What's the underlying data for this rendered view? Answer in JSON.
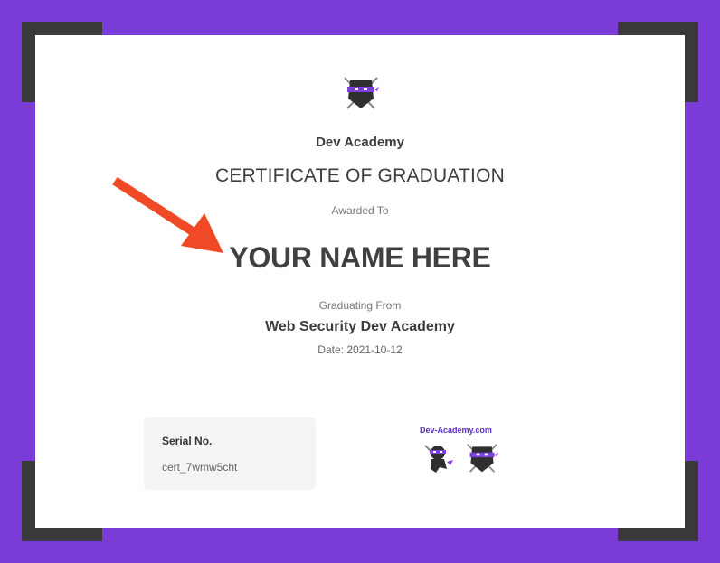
{
  "certificate": {
    "academy_name": "Dev Academy",
    "title": "CERTIFICATE OF GRADUATION",
    "awarded_to_label": "Awarded To",
    "recipient_name": "YOUR NAME HERE",
    "graduating_from_label": "Graduating From",
    "program_name": "Web Security Dev Academy",
    "date": "Date: 2021-10-12"
  },
  "serial": {
    "label": "Serial No.",
    "value": "cert_7wmw5cht"
  },
  "brand": {
    "url": "Dev-Academy.com"
  },
  "colors": {
    "border_purple": "#7a3bd6",
    "corner_dark": "#3a3a3a",
    "arrow_red": "#ef4a25",
    "ninja_band": "#7d3fe0"
  },
  "icons": [
    "ninja-logo-icon",
    "ninja-mascot-icon",
    "arrow-annotation-icon"
  ]
}
